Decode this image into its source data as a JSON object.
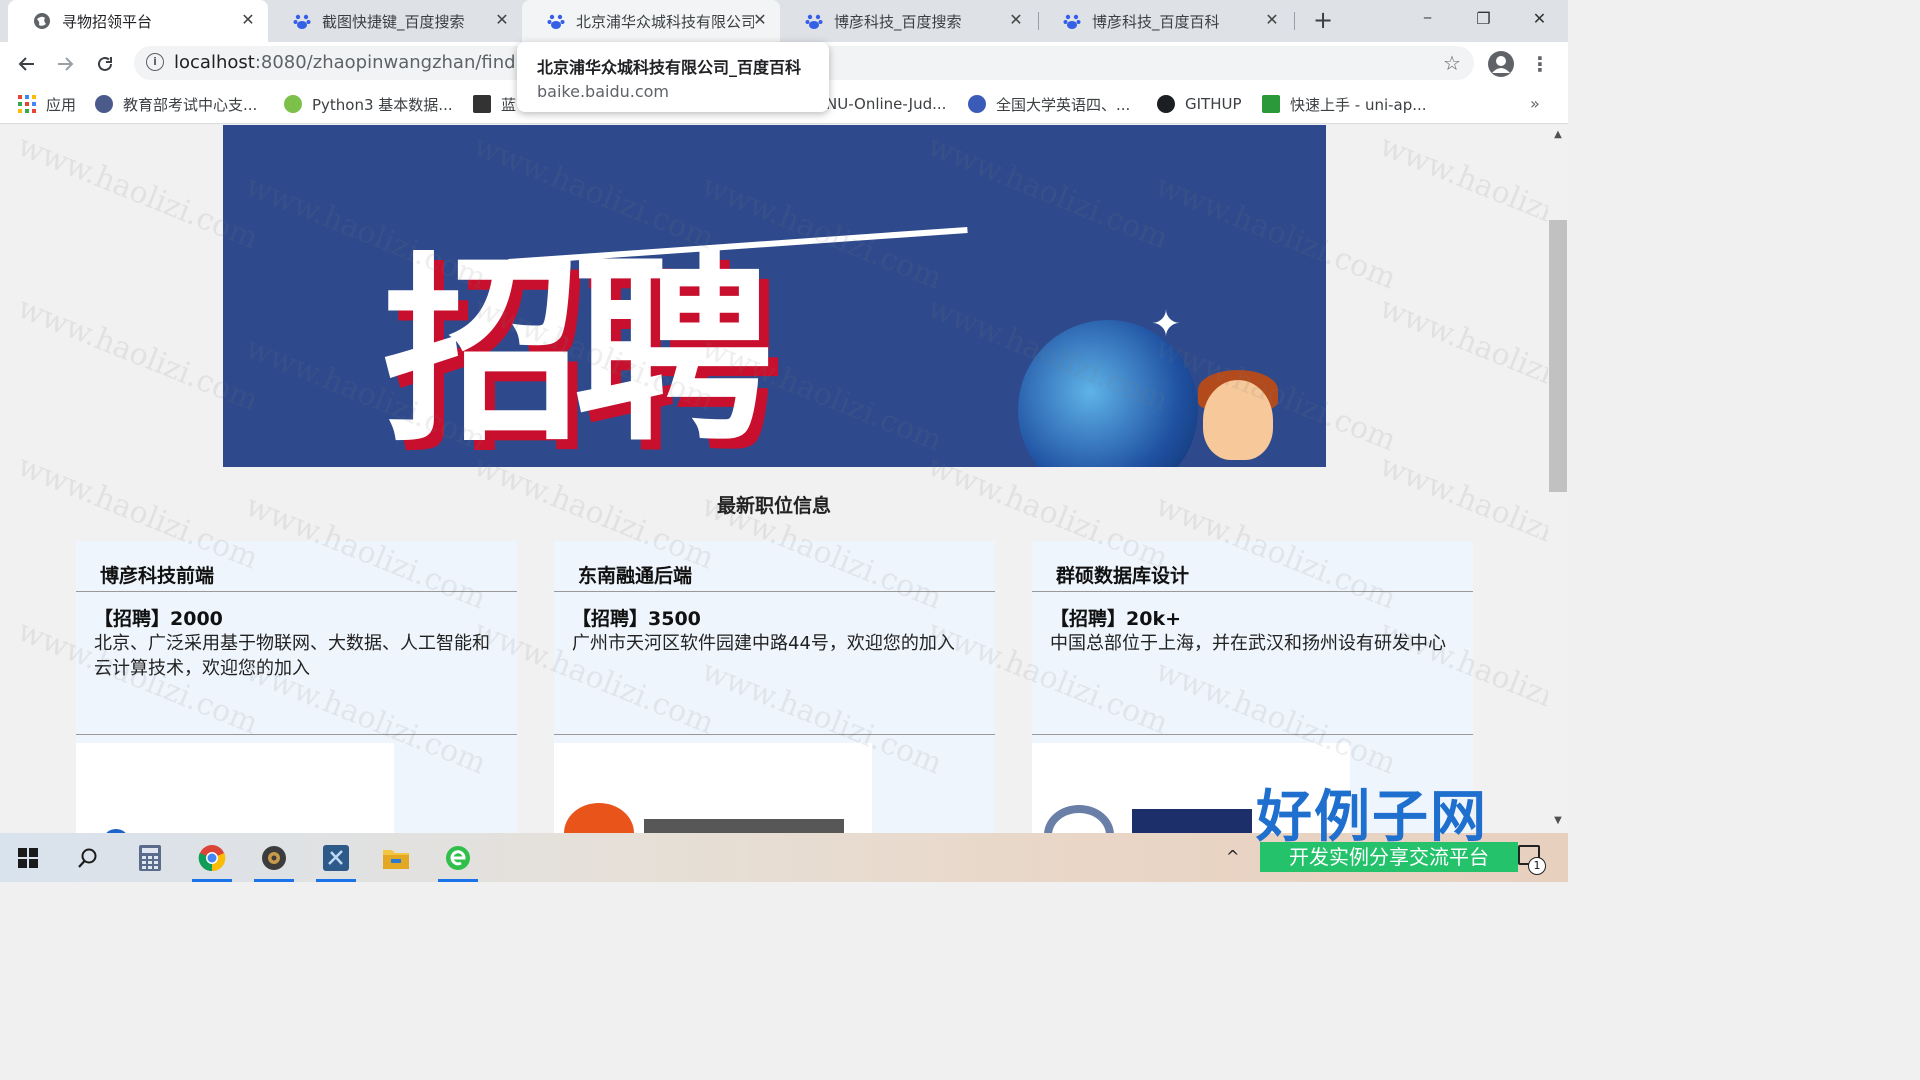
{
  "browser": {
    "tabs": [
      {
        "title": "寻物招领平台",
        "active": true
      },
      {
        "title": "截图快捷键_百度搜索",
        "active": false
      },
      {
        "title": "北京浦华众城科技有限公司",
        "active": false
      },
      {
        "title": "博彦科技_百度搜索",
        "active": false
      },
      {
        "title": "博彦科技_百度百科",
        "active": false
      }
    ],
    "new_tab": "+",
    "window_controls": {
      "minimize": "─",
      "restore": "❐",
      "close": "✕"
    },
    "url": {
      "host": "localhost",
      "path": ":8080/zhaopinwangzhan/find.jsp"
    },
    "tooltip": {
      "title": "北京浦华众城科技有限公司_百度百科",
      "url": "baike.baidu.com"
    },
    "bookmarks": [
      {
        "label": "应用",
        "icon": "apps-grid-icon"
      },
      {
        "label": "教育部考试中心支...",
        "icon": "globe-icon"
      },
      {
        "label": "Python3 基本数据...",
        "icon": "python-icon"
      },
      {
        "label": "蓝",
        "icon": "c-icon"
      },
      {
        "label": "NU-Online-Jud...",
        "icon": "oj-icon"
      },
      {
        "label": "全国大学英语四、...",
        "icon": "globe-icon"
      },
      {
        "label": "GITHUP",
        "icon": "github-icon"
      },
      {
        "label": "快速上手 - uni-ap...",
        "icon": "uniapp-icon"
      }
    ],
    "bookmarks_more": "»"
  },
  "page": {
    "banner_text": "招聘",
    "section_title": "最新职位信息",
    "jobs": [
      {
        "title": "博彦科技前端",
        "salary": "【招聘】2000",
        "desc": "北京、广泛采用基于物联网、大数据、人工智能和云计算技术，欢迎您的加入"
      },
      {
        "title": "东南融通后端",
        "salary": "【招聘】3500",
        "desc": "广州市天河区软件园建中路44号，欢迎您的加入"
      },
      {
        "title": "群硕数据库设计",
        "salary": "【招聘】20k+",
        "desc": "中国总部位于上海，并在武汉和扬州设有研发中心"
      }
    ]
  },
  "watermark": {
    "text": "www.haolizi.com",
    "brand": "好例子网",
    "brand_sub": "开发实例分享交流平台"
  },
  "taskbar": {
    "apps": [
      "windows-start-icon",
      "search-icon",
      "calculator-icon",
      "chrome-icon",
      "settings-app-icon",
      "vscode-icon",
      "file-explorer-icon",
      "browser-e-icon"
    ],
    "tray_arrow": "^",
    "notification_count": "1"
  },
  "colors": {
    "accent": "#1a73e8",
    "banner_bg": "#2e4a8c",
    "card_bg": "#eef5fc",
    "brand": "#1f6fcf",
    "brand_sub_bg": "#23c26b"
  }
}
